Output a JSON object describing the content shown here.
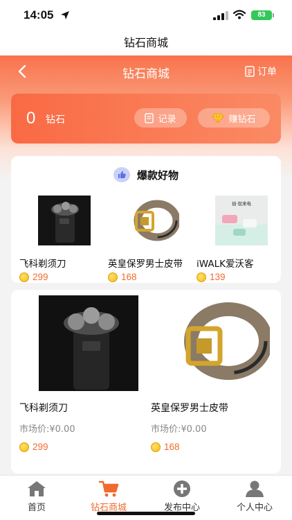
{
  "status": {
    "time": "14:05",
    "battery": "83"
  },
  "page_title": "钻石商城",
  "nav": {
    "title": "钻石商城",
    "order_label": "订单"
  },
  "wallet": {
    "count": "0",
    "unit": "钻石",
    "record_label": "记录",
    "earn_label": "赚钻石"
  },
  "hot": {
    "title": "爆款好物",
    "items": [
      {
        "name": "飞科剃须刀",
        "price": "299"
      },
      {
        "name": "英皇保罗男士皮带",
        "price": "168"
      },
      {
        "name": "iWALK爱沃客",
        "price": "139",
        "image_text": "插·就来电"
      }
    ]
  },
  "products": [
    {
      "name": "飞科剃须刀",
      "market_price": "市场价:¥0.00",
      "price": "299"
    },
    {
      "name": "英皇保罗男士皮带",
      "market_price": "市场价:¥0.00",
      "price": "168"
    }
  ],
  "tabs": [
    {
      "label": "首页",
      "icon": "home-icon"
    },
    {
      "label": "钻石商城",
      "icon": "cart-icon"
    },
    {
      "label": "发布中心",
      "icon": "plus-circle-icon"
    },
    {
      "label": "个人中心",
      "icon": "user-icon"
    }
  ],
  "colors": {
    "accent": "#f06b2f",
    "price": "#f26b2e",
    "header": "#f8734c"
  }
}
